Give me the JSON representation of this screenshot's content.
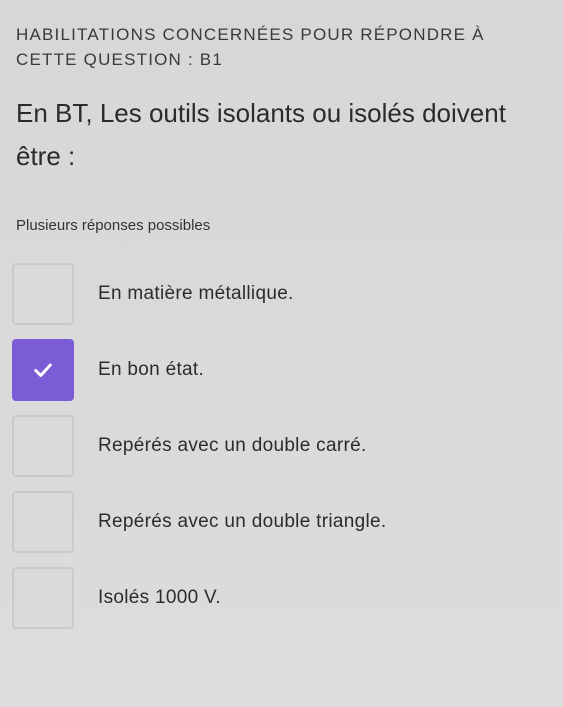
{
  "header": {
    "habilitation_text": "HABILITATIONS CONCERNÉES POUR RÉPONDRE À CETTE QUESTION : B1"
  },
  "question": {
    "text": "En BT, Les outils isolants ou isolés doivent être :",
    "hint": "Plusieurs réponses possibles"
  },
  "options": [
    {
      "label": "En matière métallique.",
      "checked": false
    },
    {
      "label": "En bon état.",
      "checked": true
    },
    {
      "label": "Repérés avec un double carré.",
      "checked": false
    },
    {
      "label": "Repérés avec un double triangle.",
      "checked": false
    },
    {
      "label": "Isolés 1000 V.",
      "checked": false
    }
  ],
  "colors": {
    "accent": "#7b5cd6",
    "background": "#d8d8d8"
  },
  "icons": {
    "check": "checkmark-icon"
  }
}
